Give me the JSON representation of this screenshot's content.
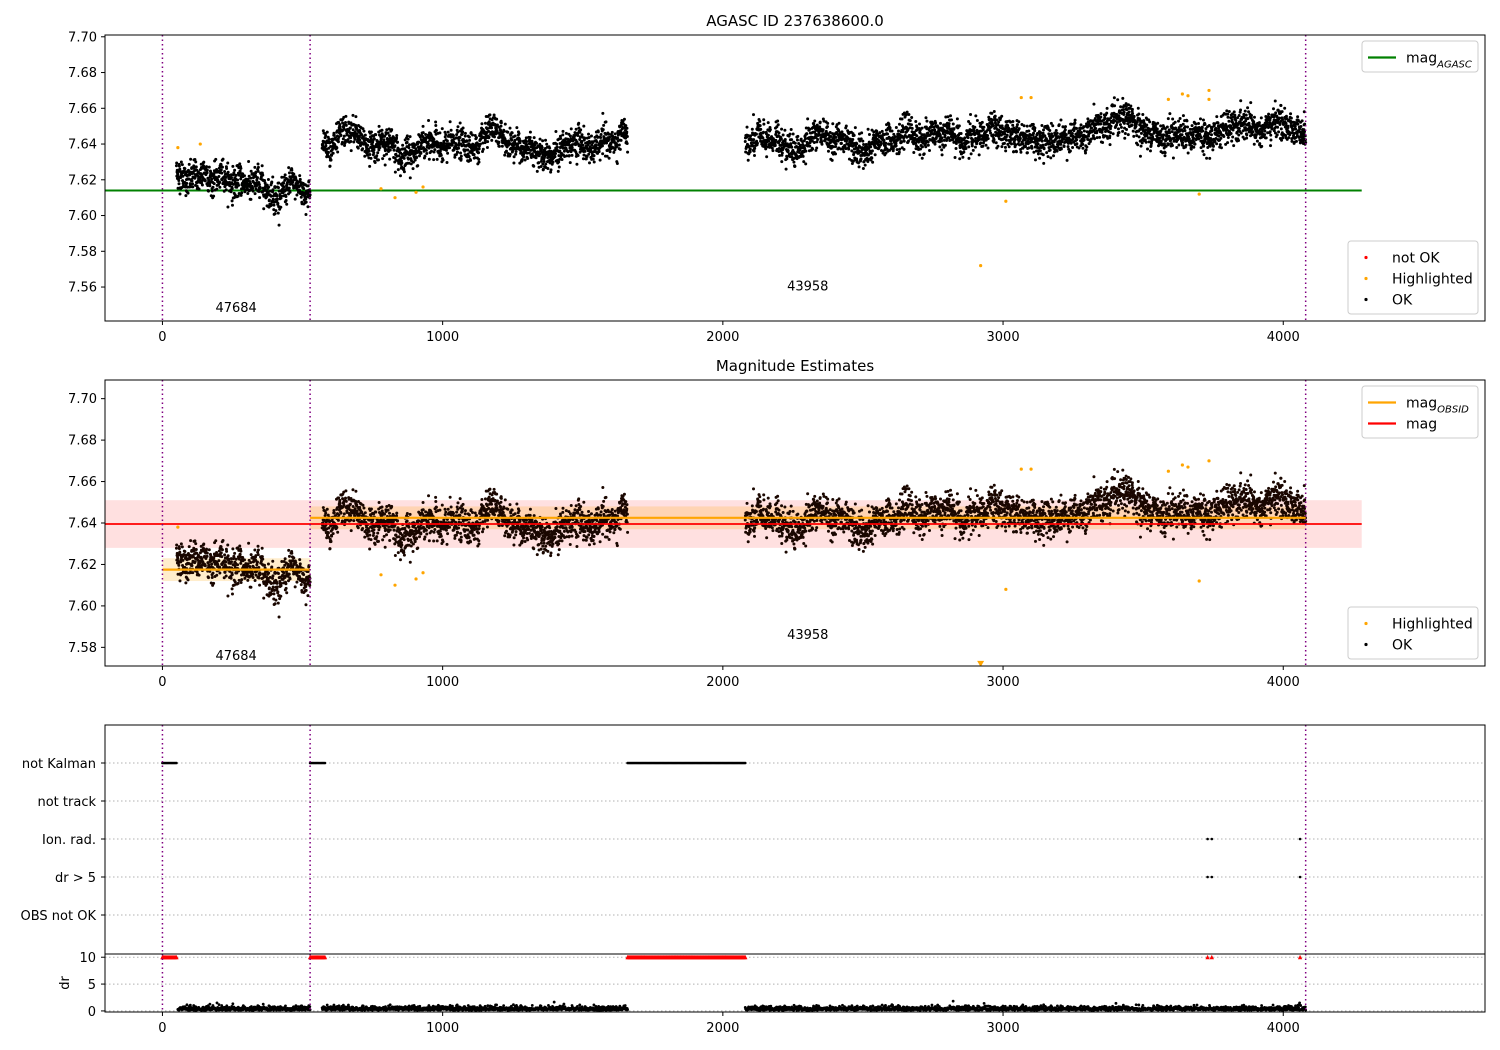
{
  "chart_data": [
    {
      "type": "scatter",
      "panel": "top",
      "title": "AGASC ID 237638600.0",
      "xlim": [
        -205,
        4720
      ],
      "ylim": [
        7.541,
        7.701
      ],
      "xticks": [
        0,
        1000,
        2000,
        3000,
        4000
      ],
      "yticks": [
        7.56,
        7.58,
        7.6,
        7.62,
        7.64,
        7.66,
        7.68,
        7.7
      ],
      "ytick_labels": [
        "7.56",
        "7.58",
        "7.60",
        "7.62",
        "7.64",
        "7.66",
        "7.68",
        "7.70"
      ],
      "obsid_boundaries": [
        0,
        527,
        4080
      ],
      "obsid_labels": [
        {
          "text": "47684",
          "x": 263,
          "y": 7.546
        },
        {
          "text": "43958",
          "x": 2303,
          "y": 7.558
        }
      ],
      "mag_agasc": 7.614,
      "mag_agasc_xrange": [
        -205,
        4280
      ],
      "segments": [
        {
          "x": [
            50,
            527
          ],
          "mean_start": 7.624,
          "mean_end": 7.613,
          "noise": 0.007
        },
        {
          "x": [
            570,
            1660
          ],
          "mean_start": 7.64,
          "mean_end": 7.638,
          "noise": 0.007
        },
        {
          "x": [
            2080,
            4080
          ],
          "mean_start": 7.64,
          "mean_end": 7.65,
          "noise": 0.007
        }
      ],
      "highlighted_points": [
        {
          "x": 55,
          "y": 7.638
        },
        {
          "x": 135,
          "y": 7.64
        },
        {
          "x": 780,
          "y": 7.615
        },
        {
          "x": 830,
          "y": 7.61
        },
        {
          "x": 905,
          "y": 7.613
        },
        {
          "x": 930,
          "y": 7.616
        },
        {
          "x": 2920,
          "y": 7.572
        },
        {
          "x": 3010,
          "y": 7.608
        },
        {
          "x": 3065,
          "y": 7.666
        },
        {
          "x": 3100,
          "y": 7.666
        },
        {
          "x": 3590,
          "y": 7.665
        },
        {
          "x": 3640,
          "y": 7.668
        },
        {
          "x": 3660,
          "y": 7.667
        },
        {
          "x": 3700,
          "y": 7.612
        },
        {
          "x": 3735,
          "y": 7.67
        },
        {
          "x": 3735,
          "y": 7.665
        }
      ],
      "legends": [
        {
          "position": "upper-right",
          "entries": [
            {
              "label": "mag",
              "sub": "AGASC",
              "color": "#008000",
              "kind": "line"
            }
          ]
        },
        {
          "position": "lower-right",
          "entries": [
            {
              "label": "not OK",
              "color": "#ff0000",
              "kind": "dot"
            },
            {
              "label": "Highlighted",
              "color": "#ffa500",
              "kind": "dot"
            },
            {
              "label": "OK",
              "color": "#000000",
              "kind": "dot"
            }
          ]
        }
      ]
    },
    {
      "type": "scatter",
      "panel": "middle",
      "title": "Magnitude Estimates",
      "xlim": [
        -205,
        4720
      ],
      "ylim": [
        7.571,
        7.709
      ],
      "xticks": [
        0,
        1000,
        2000,
        3000,
        4000
      ],
      "yticks": [
        7.58,
        7.6,
        7.62,
        7.64,
        7.66,
        7.68,
        7.7
      ],
      "ytick_labels": [
        "7.58",
        "7.60",
        "7.62",
        "7.64",
        "7.66",
        "7.68",
        "7.70"
      ],
      "obsid_boundaries": [
        0,
        527,
        4080
      ],
      "obsid_labels": [
        {
          "text": "47684",
          "x": 263,
          "y": 7.574
        },
        {
          "text": "43958",
          "x": 2303,
          "y": 7.584
        }
      ],
      "mag": {
        "value": 7.6395,
        "band": [
          7.628,
          7.651
        ],
        "xrange": [
          -205,
          4280
        ]
      },
      "mag_obsid": [
        {
          "x": [
            0,
            527
          ],
          "value": 7.6175,
          "band": [
            7.612,
            7.623
          ]
        },
        {
          "x": [
            527,
            4080
          ],
          "value": 7.6425,
          "band": [
            7.637,
            7.648
          ]
        }
      ],
      "highlighted_points": [
        {
          "x": 55,
          "y": 7.638
        },
        {
          "x": 780,
          "y": 7.615
        },
        {
          "x": 830,
          "y": 7.61
        },
        {
          "x": 905,
          "y": 7.613
        },
        {
          "x": 930,
          "y": 7.616
        },
        {
          "x": 3010,
          "y": 7.608
        },
        {
          "x": 3065,
          "y": 7.666
        },
        {
          "x": 3100,
          "y": 7.666
        },
        {
          "x": 3590,
          "y": 7.665
        },
        {
          "x": 3640,
          "y": 7.668
        },
        {
          "x": 3660,
          "y": 7.667
        },
        {
          "x": 3700,
          "y": 7.612
        },
        {
          "x": 3735,
          "y": 7.67
        }
      ],
      "clipped_marker": {
        "x": 2920,
        "y": 7.572
      },
      "legends": [
        {
          "position": "upper-right",
          "entries": [
            {
              "label": "mag",
              "sub": "OBSID",
              "color": "#ffa500",
              "kind": "line"
            },
            {
              "label": "mag",
              "sub": "",
              "color": "#ff0000",
              "kind": "line"
            }
          ]
        },
        {
          "position": "lower-right",
          "entries": [
            {
              "label": "Highlighted",
              "color": "#ffa500",
              "kind": "dot"
            },
            {
              "label": "OK",
              "color": "#000000",
              "kind": "dot"
            }
          ]
        }
      ]
    },
    {
      "type": "scatter",
      "panel": "flags",
      "xlim": [
        -205,
        4720
      ],
      "categories": [
        "not Kalman",
        "not track",
        "Ion. rad.",
        "dr > 5",
        "OBS not OK"
      ],
      "flag_ranges": [
        {
          "category": "not Kalman",
          "x": [
            0,
            50
          ]
        },
        {
          "category": "not Kalman",
          "x": [
            527,
            580
          ]
        },
        {
          "category": "not Kalman",
          "x": [
            1660,
            2080
          ]
        }
      ],
      "flag_points": [
        {
          "category": "Ion. rad.",
          "x": [
            3730,
            3745,
            4060
          ]
        },
        {
          "category": "dr > 5",
          "x": [
            3730,
            3745,
            4060
          ]
        }
      ],
      "obsid_boundaries": [
        0,
        527,
        4080
      ]
    },
    {
      "type": "scatter",
      "panel": "dr",
      "ylabel": "dr",
      "xlim": [
        -205,
        4720
      ],
      "ylim": [
        -0.2,
        10.6
      ],
      "xticks": [
        0,
        1000,
        2000,
        3000,
        4000
      ],
      "yticks": [
        0,
        5,
        10
      ],
      "dr_ok_ranges": [
        [
          55,
          527
        ],
        [
          570,
          1660
        ],
        [
          2080,
          4080
        ]
      ],
      "dr_capped_ranges": [
        [
          0,
          50
        ],
        [
          527,
          580
        ],
        [
          1660,
          2080
        ]
      ],
      "dr_capped_points": [
        3730,
        3745,
        4060
      ],
      "dr_cap": 10,
      "obsid_boundaries": [
        0,
        527,
        4080
      ]
    }
  ]
}
